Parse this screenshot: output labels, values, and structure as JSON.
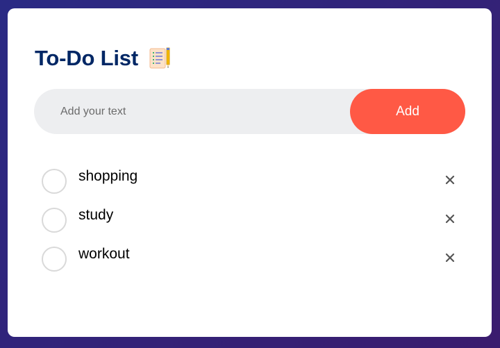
{
  "app": {
    "title": "To-Do List",
    "title_icon": "notepad-pencil-icon"
  },
  "input": {
    "placeholder": "Add your text",
    "value": ""
  },
  "add_button": {
    "label": "Add"
  },
  "tasks": [
    {
      "label": "shopping",
      "checked": false
    },
    {
      "label": "study",
      "checked": false
    },
    {
      "label": "workout",
      "checked": false
    }
  ],
  "colors": {
    "background_start": "#2a2a84",
    "background_end": "#3a1c6e",
    "card": "#ffffff",
    "title": "#002765",
    "accent": "#ff5945",
    "input_bg": "#edeef0",
    "circle_border": "#d9d9d9",
    "remove_icon": "#555555"
  },
  "icons": {
    "remove": "close-icon",
    "checkbox": "circle-icon"
  }
}
